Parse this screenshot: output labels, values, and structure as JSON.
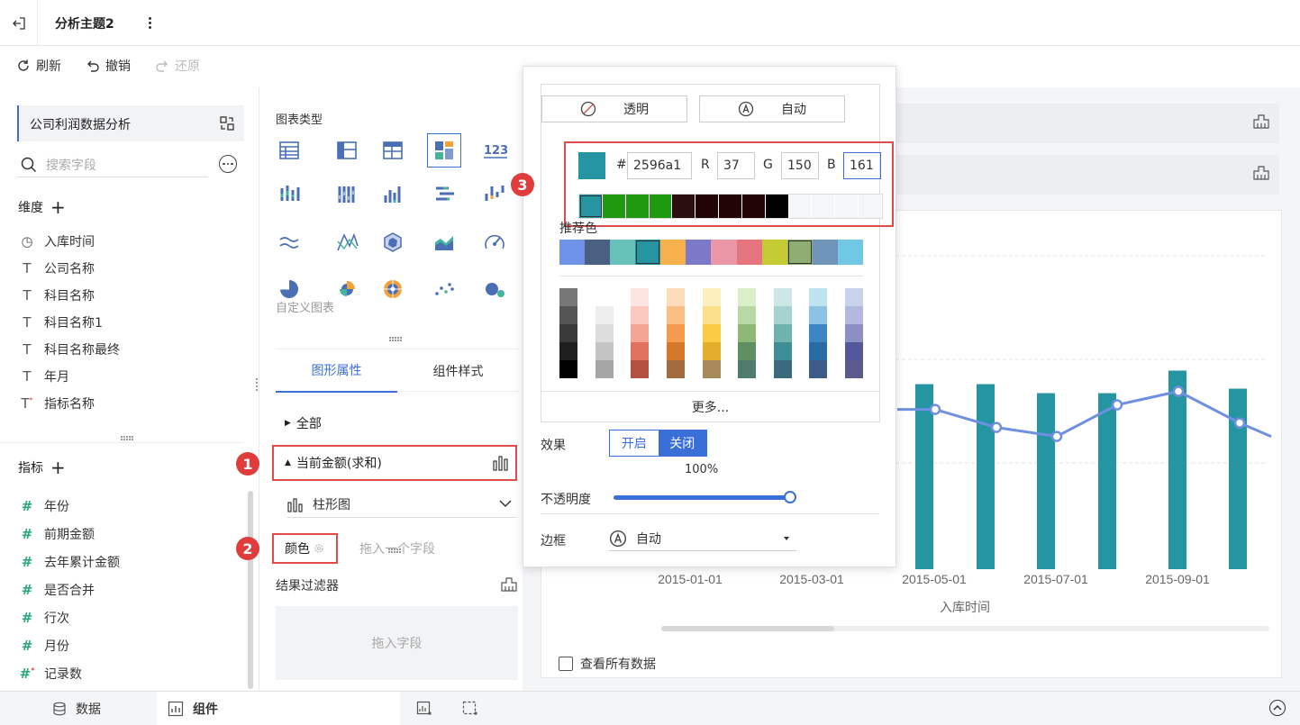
{
  "header": {
    "title": "分析主题2",
    "back_icon": "exit-icon",
    "more_icon": "more-vertical-icon"
  },
  "toolbar": {
    "refresh": "刷新",
    "undo": "撤销",
    "redo": "还原"
  },
  "left": {
    "dataset": "公司利润数据分析",
    "search_placeholder": "搜索字段",
    "dimension_title": "维度",
    "dimensions": [
      {
        "label": "入库时间",
        "type": "date"
      },
      {
        "label": "公司名称",
        "type": "text"
      },
      {
        "label": "科目名称",
        "type": "text"
      },
      {
        "label": "科目名称1",
        "type": "text"
      },
      {
        "label": "科目名称最终",
        "type": "text"
      },
      {
        "label": "年月",
        "type": "text"
      },
      {
        "label": "指标名称",
        "type": "text-calc"
      }
    ],
    "measure_title": "指标",
    "measures": [
      {
        "label": "年份",
        "type": "num"
      },
      {
        "label": "前期金额",
        "type": "num"
      },
      {
        "label": "去年累计金额",
        "type": "num"
      },
      {
        "label": "是否合并",
        "type": "num"
      },
      {
        "label": "行次",
        "type": "num"
      },
      {
        "label": "月份",
        "type": "num"
      },
      {
        "label": "记录数",
        "type": "num-calc"
      }
    ]
  },
  "middle": {
    "chart_type_label": "图表类型",
    "custom_chart": "自定义图表",
    "tabs": [
      "图形属性",
      "组件样式"
    ],
    "all": "全部",
    "measure_field": "当前金额(求和)",
    "chart_kind": "柱形图",
    "color_label": "颜色",
    "color_drop": "拖入一个字段",
    "filter_label": "结果过滤器",
    "filter_drop": "拖入字段",
    "badges": [
      "1",
      "2",
      "3"
    ]
  },
  "popover": {
    "transparent": "透明",
    "auto": "自动",
    "hex_prefix": "#",
    "hex": "2596a1",
    "r_label": "R",
    "r": "37",
    "g_label": "G",
    "g": "150",
    "b_label": "B",
    "b": "161",
    "current_color": "#2596a1",
    "recent_colors": [
      "#2596a1",
      "#1f9a10",
      "#1f9a10",
      "#1f9a10",
      "#2a0f0f",
      "#220404",
      "#220404",
      "#220404",
      "#000000",
      "#f4f6f9",
      "#f4f6f9",
      "#f4f6f9",
      "#f4f6f9"
    ],
    "recommended_label": "推荐色",
    "recommended": [
      "#6f93e8",
      "#4a5f82",
      "#66c2b9",
      "#2596a1",
      "#f7b14c",
      "#7c79c8",
      "#ec97a7",
      "#e5757e",
      "#c4cb34",
      "#8fae73",
      "#6e95b9",
      "#70c8e4"
    ],
    "gradients": [
      [
        "#777777",
        "#555555",
        "#3a3a3a",
        "#1f1f1f",
        "#000000"
      ],
      [
        "#ffffff",
        "#eeeeee",
        "#dddddd",
        "#c4c4c4",
        "#a6a6a6"
      ],
      [
        "#fde6e1",
        "#fbc9bf",
        "#f5a594",
        "#e0725d",
        "#b4503f"
      ],
      [
        "#fddcbb",
        "#fbbf85",
        "#f39b4e",
        "#d6782b",
        "#a46b3f"
      ],
      [
        "#fdf0bf",
        "#fde08c",
        "#fccb46",
        "#e4ad2b",
        "#a8895a"
      ],
      [
        "#d9efc9",
        "#b8d8a6",
        "#8fb877",
        "#5e8f63",
        "#4e7b6c"
      ],
      [
        "#cde7e6",
        "#a6d2d0",
        "#6fb2ae",
        "#3d8f95",
        "#3a6b7d"
      ],
      [
        "#bfe2ef",
        "#8cc2e3",
        "#3c86c4",
        "#2a6aa5",
        "#3c5b86"
      ],
      [
        "#c8d2ea",
        "#b4b8de",
        "#8d8fc2",
        "#54589a",
        "#5b5a8c"
      ]
    ],
    "more": "更多...",
    "effect_label": "效果",
    "effect_on": "开启",
    "effect_off": "关闭",
    "opacity_value": "100%",
    "opacity_label": "不透明度",
    "opacity_fraction": 1.0,
    "border_label": "边框",
    "border_value": "自动"
  },
  "chart_data": {
    "type": "bar",
    "xlabel": "入库时间",
    "x_ticks": [
      "2015-01-01",
      "2015-03-01",
      "2015-05-01",
      "2015-07-01",
      "2015-09-01"
    ],
    "bar_color": "#2596a1",
    "line_color": "#6f8fe0",
    "visible_bar_heights": [
      0.82,
      0.82,
      0.78,
      0.78,
      0.88,
      0.8
    ],
    "visible_line_points": [
      0.78,
      0.78,
      0.7,
      0.66,
      0.8,
      0.86,
      0.72
    ],
    "view_all": "查看所有数据"
  },
  "bottom": {
    "data_tab": "数据",
    "component_tab": "组件"
  }
}
